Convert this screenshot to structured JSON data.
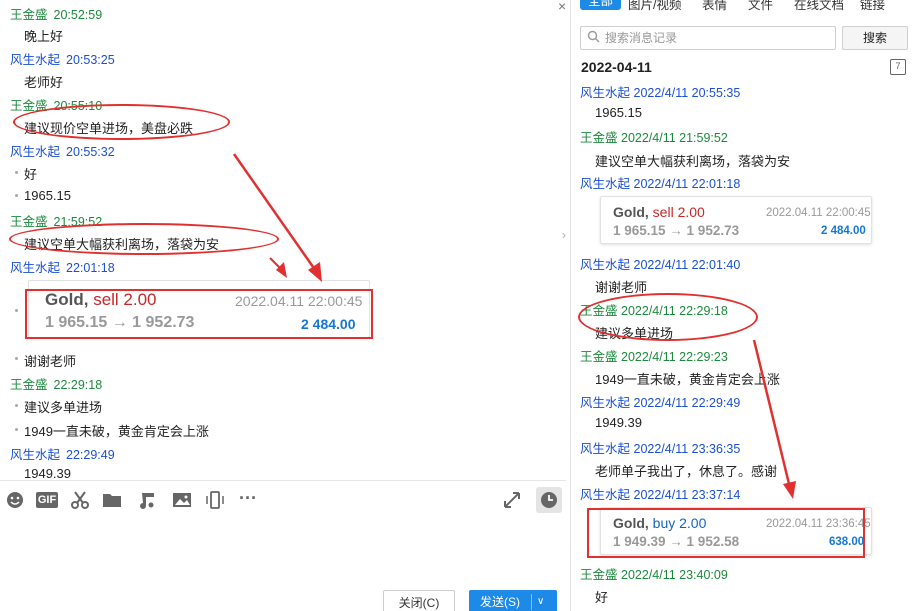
{
  "left_chat": {
    "messages": [
      {
        "sender": "王金盛",
        "time": "20:52:59",
        "text": "晚上好"
      },
      {
        "sender": "风生水起",
        "time": "20:53:25",
        "text": "老师好"
      },
      {
        "sender": "王金盛",
        "time": "20:55:10",
        "text": "建议现价空单进场，美盘必跌"
      },
      {
        "sender": "风生水起",
        "time": "20:55:32",
        "texts": [
          "好",
          "1965.15"
        ]
      },
      {
        "sender": "王金盛",
        "time": "21:59:52",
        "text": "建议空单大幅获利离场，落袋为安"
      },
      {
        "sender": "风生水起",
        "time": "22:01:18",
        "texts": [
          "谢谢老师"
        ]
      },
      {
        "sender": "王金盛",
        "time": "22:29:18",
        "texts": [
          "建议多单进场",
          "1949一直未破，黄金肯定会上涨"
        ]
      },
      {
        "sender": "风生水起",
        "time": "22:29:49",
        "text": "1949.39"
      }
    ],
    "trade_card": {
      "symbol": "Gold,",
      "side": "sell 2.00",
      "datetime": "2022.04.11 22:00:45",
      "prices": "1 965.15 → 1 952.73",
      "profit": "2 484.00"
    }
  },
  "toolbar": {
    "icons": [
      "emoji-icon",
      "gif-icon",
      "scissors-icon",
      "folder-icon",
      "music-icon",
      "image-icon",
      "shake-icon",
      "more-icon",
      "expand-icon",
      "clock-icon"
    ],
    "gif_label": "GIF",
    "more_label": "···"
  },
  "buttons": {
    "close_label": "关闭(C)",
    "send_label": "发送(S)"
  },
  "right_panel": {
    "tabs": [
      "全部",
      "图片/视频",
      "表情",
      "文件",
      "在线文档",
      "链接"
    ],
    "search_placeholder": "搜索消息记录",
    "search_button": "搜索",
    "date_heading": "2022-04-11",
    "calendar_label": "7",
    "entries": [
      {
        "sender": "风生水起",
        "time": "2022/4/11 20:55:35",
        "text": "1965.15"
      },
      {
        "sender": "王金盛",
        "time": "2022/4/11 21:59:52",
        "text": "建议空单大幅获利离场，落袋为安"
      },
      {
        "sender": "风生水起",
        "time": "2022/4/11 22:01:18"
      },
      {
        "sender": "风生水起",
        "time": "2022/4/11 22:01:40",
        "text": "谢谢老师"
      },
      {
        "sender": "王金盛",
        "time": "2022/4/11 22:29:18",
        "text": "建议多单进场"
      },
      {
        "sender": "王金盛",
        "time": "2022/4/11 22:29:23",
        "text": "1949一直未破，黄金肯定会上涨"
      },
      {
        "sender": "风生水起",
        "time": "2022/4/11 22:29:49",
        "text": "1949.39"
      },
      {
        "sender": "风生水起",
        "time": "2022/4/11 23:36:35",
        "text": "老师单子我出了，休息了。感谢"
      },
      {
        "sender": "风生水起",
        "time": "2022/4/11 23:37:14"
      },
      {
        "sender": "王金盛",
        "time": "2022/4/11 23:40:09",
        "text": "好"
      }
    ],
    "card_sell": {
      "symbol": "Gold,",
      "side": "sell 2.00",
      "datetime": "2022.04.11 22:00:45",
      "prices": "1 965.15 → 1 952.73",
      "profit": "2 484.00"
    },
    "card_buy": {
      "symbol": "Gold,",
      "side": "buy 2.00",
      "datetime": "2022.04.11 23:36:45",
      "prices": "1 949.39 → 1 952.58",
      "profit": "638.00"
    }
  },
  "colors": {
    "teacher_name": "#1c8a3c",
    "student_name": "#1a4fd6",
    "annotation": "#e0302f",
    "accent": "#1e8ae8"
  }
}
